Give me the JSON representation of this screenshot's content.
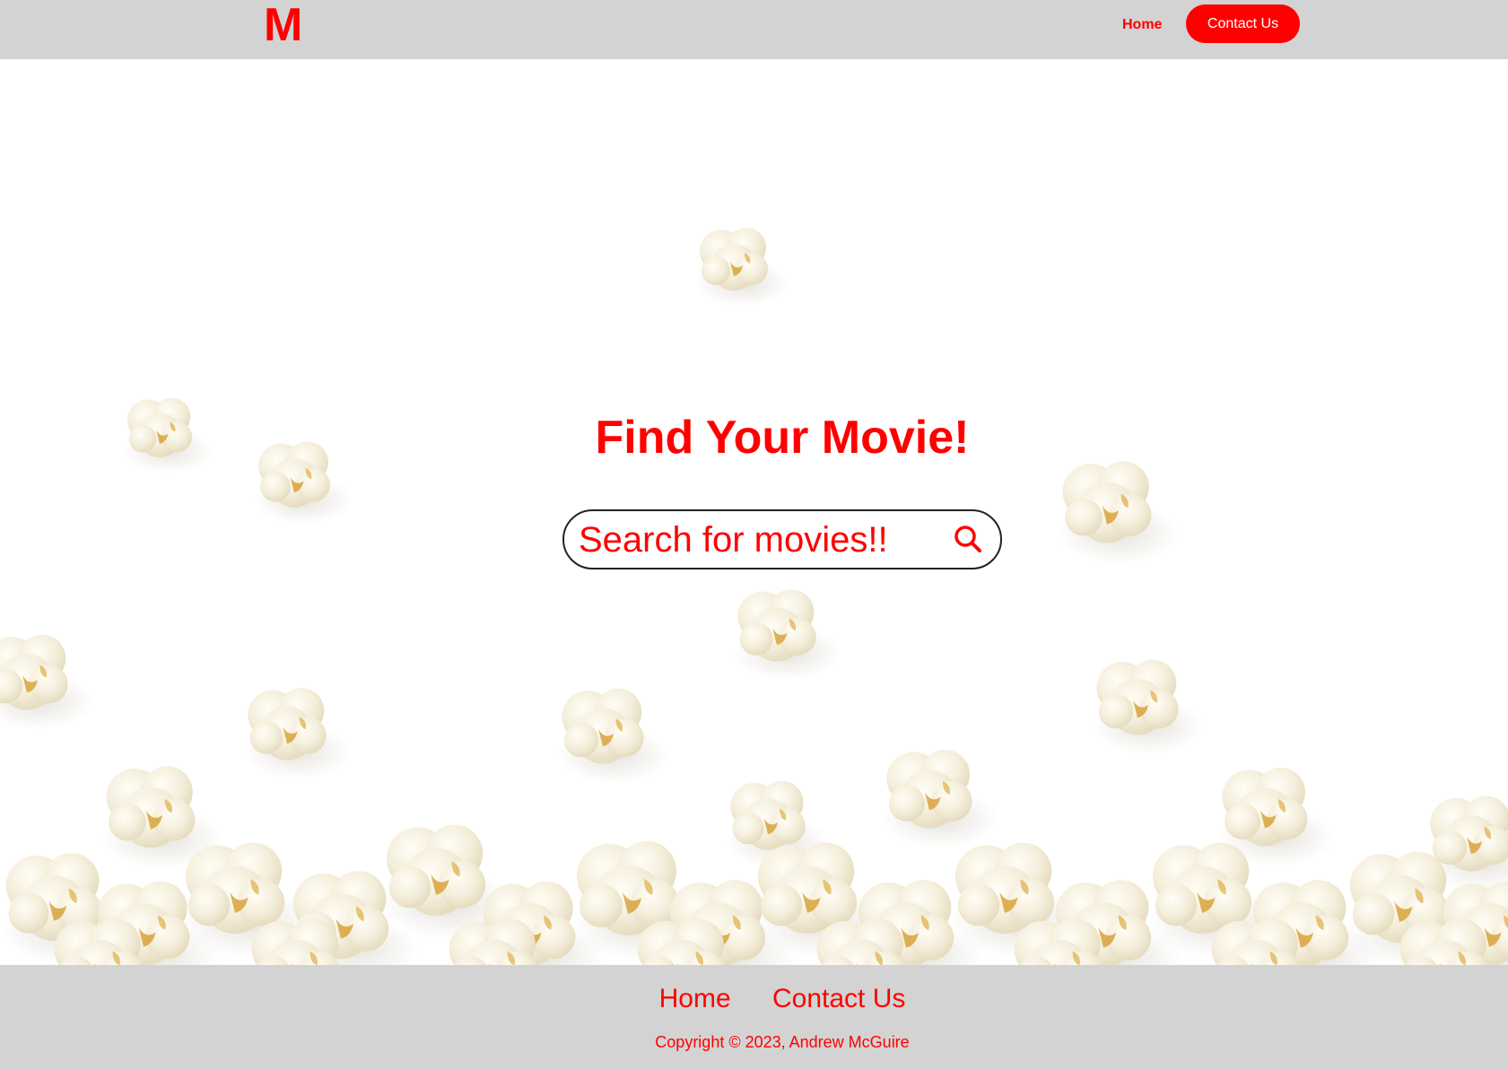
{
  "header": {
    "logo": "M",
    "nav": {
      "home_label": "Home",
      "contact_label": "Contact Us"
    }
  },
  "hero": {
    "title": "Find Your Movie!",
    "search": {
      "placeholder": "Search for movies!!",
      "button_icon": "search-icon"
    },
    "background": "popcorn"
  },
  "footer": {
    "links": [
      "Home",
      "Contact Us"
    ],
    "copyright": "Copyright © 2023, Andrew McGuire"
  },
  "colors": {
    "accent": "#ff0000",
    "bar_background": "#d3d3d3",
    "page_background": "#ffffff"
  }
}
